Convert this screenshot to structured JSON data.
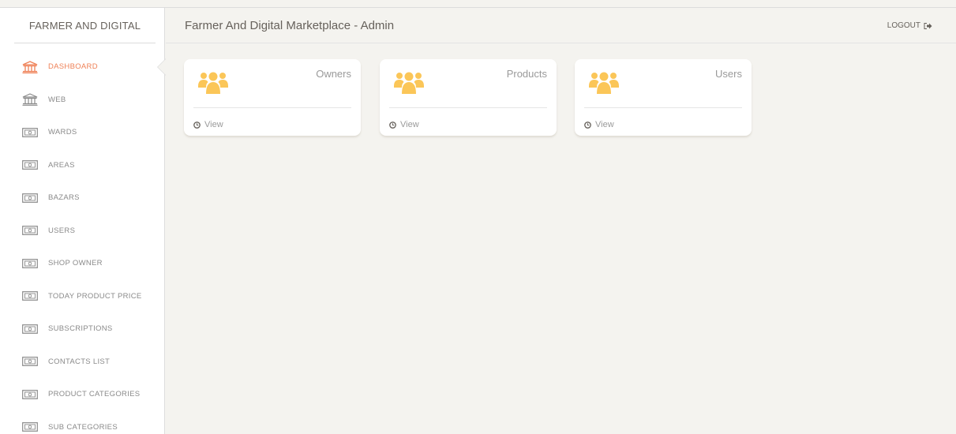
{
  "sidebar": {
    "brand": "FARMER AND DIGITAL",
    "items": [
      {
        "label": "DASHBOARD",
        "icon": "bank-icon"
      },
      {
        "label": "WEB",
        "icon": "bank-icon"
      },
      {
        "label": "WARDS",
        "icon": "money-icon"
      },
      {
        "label": "AREAS",
        "icon": "money-icon"
      },
      {
        "label": "BAZARS",
        "icon": "money-icon"
      },
      {
        "label": "USERS",
        "icon": "money-icon"
      },
      {
        "label": "SHOP OWNER",
        "icon": "money-icon"
      },
      {
        "label": "TODAY PRODUCT PRICE",
        "icon": "money-icon"
      },
      {
        "label": "SUBSCRIPTIONS",
        "icon": "money-icon"
      },
      {
        "label": "CONTACTS LIST",
        "icon": "money-icon"
      },
      {
        "label": "PRODUCT CATEGORIES",
        "icon": "money-icon"
      },
      {
        "label": "SUB CATEGORIES",
        "icon": "money-icon"
      }
    ]
  },
  "header": {
    "title": "Farmer And Digital Marketplace - Admin",
    "logout_label": "LOGOUT"
  },
  "cards": [
    {
      "label": "Owners",
      "footer": "View",
      "icon": "users-icon"
    },
    {
      "label": "Products",
      "footer": "View",
      "icon": "users-icon"
    },
    {
      "label": "Users",
      "footer": "View",
      "icon": "users-icon"
    }
  ],
  "colors": {
    "accent": "#ef8157",
    "icon_yellow": "#fbc658",
    "background": "#f4f3ef",
    "text_muted": "#9a9a9a"
  }
}
